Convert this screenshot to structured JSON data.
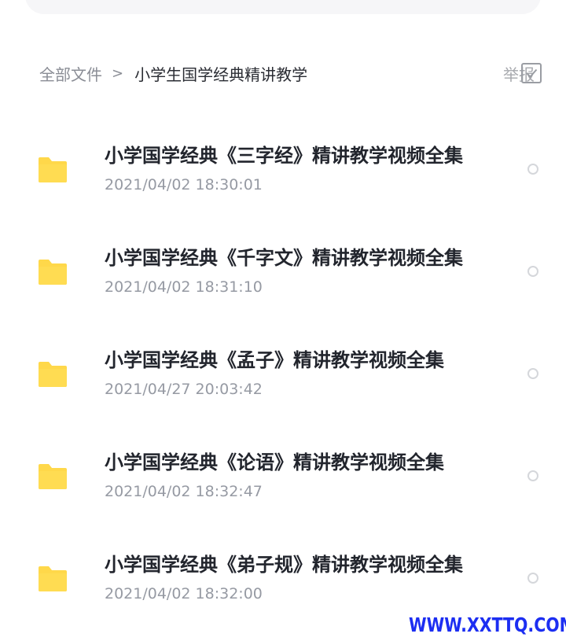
{
  "breadcrumb": {
    "root": "全部文件",
    "separator": ">",
    "current": "小学生国学经典精讲教学"
  },
  "header_actions": {
    "report_label": "举报",
    "select_all_icon": "checkbox-icon"
  },
  "files": [
    {
      "name": "小学国学经典《三字经》精讲教学视频全集",
      "date": "2021/04/02 18:30:01",
      "icon": "folder-icon"
    },
    {
      "name": "小学国学经典《千字文》精讲教学视频全集",
      "date": "2021/04/02 18:31:10",
      "icon": "folder-icon"
    },
    {
      "name": "小学国学经典《孟子》精讲教学视频全集",
      "date": "2021/04/27 20:03:42",
      "icon": "folder-icon"
    },
    {
      "name": "小学国学经典《论语》精讲教学视频全集",
      "date": "2021/04/02 18:32:47",
      "icon": "folder-icon"
    },
    {
      "name": "小学国学经典《弟子规》精讲教学视频全集",
      "date": "2021/04/02 18:32:00",
      "icon": "folder-icon"
    }
  ],
  "colors": {
    "folder": "#ffd84a",
    "title_text": "#22252d",
    "meta_text": "#969aa3",
    "watermark": "#1c2ef2"
  },
  "watermark": "WWW.XXTTQ.COM"
}
